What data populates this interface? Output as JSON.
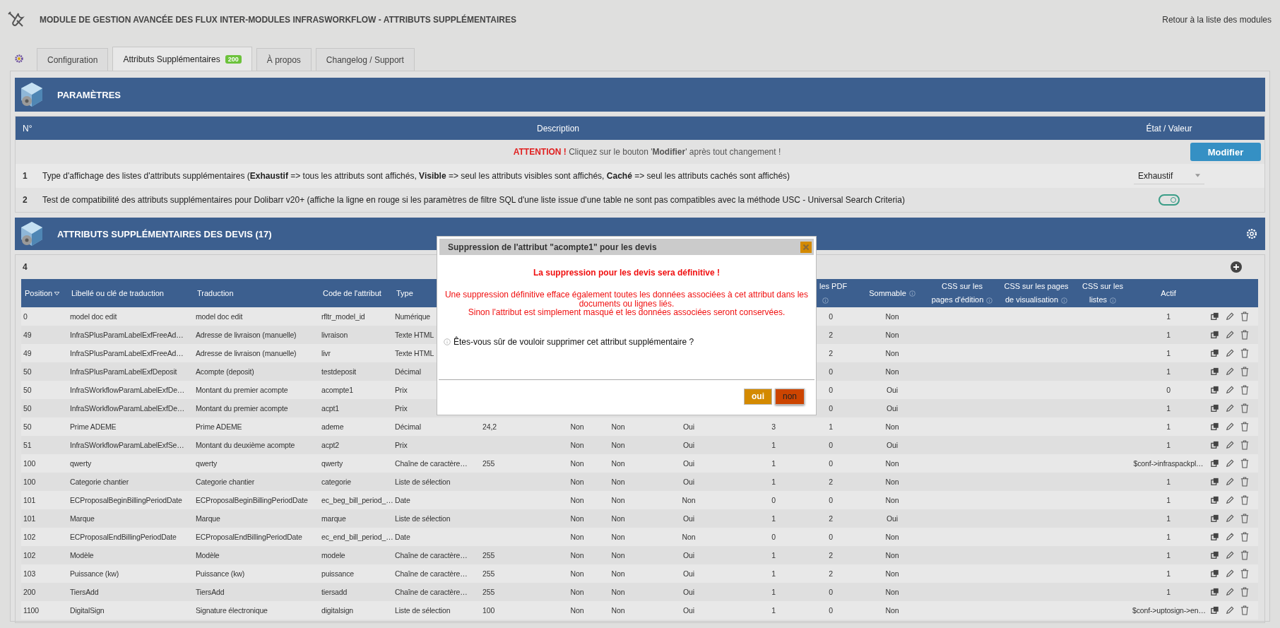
{
  "app": {
    "title": "MODULE DE GESTION AVANCÉE DES FLUX INTER-MODULES INFRASWORKFLOW - ATTRIBUTS SUPPLÉMENTAIRES",
    "back_link": "Retour à la liste des modules"
  },
  "tabs": [
    {
      "label": "Configuration",
      "selected": false
    },
    {
      "label": "Attributs Supplémentaires",
      "badge": "200",
      "selected": true
    },
    {
      "label": "À propos",
      "selected": false
    },
    {
      "label": "Changelog / Support",
      "selected": false
    }
  ],
  "parameters": {
    "title": "PARAMÈTRES",
    "columns": [
      "N°",
      "Description",
      "État / Valeur"
    ],
    "notice_label": "ATTENTION !",
    "notice": "Cliquez sur le bouton '**Modifier**' après tout changement !",
    "submit": "Modifier",
    "rows": [
      {
        "number": "1",
        "kind": "select",
        "description": "Type d'affichage des listes d'attributs supplémentaires (**Exhaustif** => tous les attributs sont affichés, **Visible** => seul les attributs visibles sont affichés, **Caché** => seul les attributs cachés sont affichés)",
        "value": "Exhaustif"
      },
      {
        "number": "2",
        "kind": "toggle",
        "description": "Test de compatibilité des attributs supplémentaires pour Dolibarr v20+ (affiche la ligne en rouge si les paramètres de filtre SQL d'une liste issue d'une table ne sont pas compatibles avec la méthode USC - Universal Search Criteria)",
        "on": true
      }
    ]
  },
  "attributes": {
    "title": "ATTRIBUTS SUPPLÉMENTAIRES DES DEVIS (17)",
    "count": "4",
    "columns": [
      {
        "label": "Position",
        "sorted": true
      },
      {
        "label": "Libellé ou clé de traduction"
      },
      {
        "label": "Traduction"
      },
      {
        "label": "Code de l'attribut"
      },
      {
        "label": "Type"
      },
      null,
      null,
      null,
      null,
      null,
      {
        "label": "les PDF",
        "info": true
      },
      {
        "label": "Sommable",
        "info": true
      },
      {
        "label": "CSS sur les pages d'édition",
        "info": true
      },
      {
        "label": "CSS sur les pages de visualisation",
        "info": true
      },
      {
        "label": "CSS sur les listes",
        "info": true
      },
      {
        "label": "Actif"
      }
    ],
    "rows": [
      {
        "cells": [
          "0",
          "model doc edit",
          "model doc edit",
          "rfltr_model_id",
          "Numérique",
          null,
          null,
          null,
          null,
          null,
          "0",
          "Non",
          null,
          null,
          null,
          "1"
        ]
      },
      {
        "cells": [
          "49",
          "InfraSPlusParamLabelExfFreeAd…",
          "Adresse de livraison (manuelle)",
          "livraison",
          "Texte HTML",
          null,
          null,
          null,
          null,
          null,
          "2",
          "Non",
          null,
          null,
          null,
          "1"
        ]
      },
      {
        "cells": [
          "49",
          "InfraSPlusParamLabelExfFreeAd…",
          "Adresse de livraison (manuelle)",
          "livr",
          "Texte HTML",
          null,
          null,
          null,
          null,
          null,
          "2",
          "Non",
          null,
          null,
          null,
          "1"
        ]
      },
      {
        "cells": [
          "50",
          "InfraSPlusParamLabelExfDeposit",
          "Acompte (deposit)",
          "testdeposit",
          "Décimal",
          null,
          null,
          null,
          null,
          null,
          "0",
          "Non",
          null,
          null,
          null,
          "1"
        ]
      },
      {
        "cells": [
          "50",
          "InfraSWorkflowParamLabelExfDe…",
          "Montant du premier acompte",
          "acompte1",
          "Prix",
          null,
          null,
          null,
          null,
          null,
          "0",
          "Oui",
          null,
          null,
          null,
          "0"
        ]
      },
      {
        "cells": [
          "50",
          "InfraSWorkflowParamLabelExfDe…",
          "Montant du premier acompte",
          "acpt1",
          "Prix",
          null,
          null,
          null,
          null,
          null,
          "0",
          "Oui",
          null,
          null,
          null,
          "1"
        ]
      },
      {
        "cells": [
          "50",
          "Prime ADEME",
          "Prime ADEME",
          "ademe",
          "Décimal",
          "24,2",
          "Non",
          "Non",
          "Oui",
          "3",
          "1",
          "Non",
          null,
          null,
          null,
          "1"
        ]
      },
      {
        "cells": [
          "51",
          "InfraSWorkflowParamLabelExfSe…",
          "Montant du deuxième acompte",
          "acpt2",
          "Prix",
          null,
          "Non",
          "Non",
          "Oui",
          "1",
          "0",
          "Oui",
          null,
          null,
          null,
          "1"
        ]
      },
      {
        "cells": [
          "100",
          "qwerty",
          "qwerty",
          "qwerty",
          "Chaîne de caractère…",
          "255",
          "Non",
          "Non",
          "Oui",
          "1",
          "0",
          "Non",
          null,
          null,
          null,
          "$conf->infraspackpl…"
        ]
      },
      {
        "cells": [
          "100",
          "Categorie chantier",
          "Categorie chantier",
          "categorie",
          "Liste de sélection",
          null,
          "Non",
          "Non",
          "Oui",
          "1",
          "2",
          "Non",
          null,
          null,
          null,
          "1"
        ]
      },
      {
        "cells": [
          "101",
          "ECProposalBeginBillingPeriodDate",
          "ECProposalBeginBillingPeriodDate",
          "ec_beg_bill_period_…",
          "Date",
          null,
          "Non",
          "Non",
          "Non",
          "0",
          "0",
          "Non",
          null,
          null,
          null,
          "1"
        ]
      },
      {
        "cells": [
          "101",
          "Marque",
          "Marque",
          "marque",
          "Liste de sélection",
          null,
          "Non",
          "Non",
          "Oui",
          "1",
          "2",
          "Oui",
          null,
          null,
          null,
          "1"
        ]
      },
      {
        "cells": [
          "102",
          "ECProposalEndBillingPeriodDate",
          "ECProposalEndBillingPeriodDate",
          "ec_end_bill_period_…",
          "Date",
          null,
          "Non",
          "Non",
          "Non",
          "0",
          "0",
          "Non",
          null,
          null,
          null,
          "1"
        ]
      },
      {
        "cells": [
          "102",
          "Modèle",
          "Modèle",
          "modele",
          "Chaîne de caractère…",
          "255",
          "Non",
          "Non",
          "Oui",
          "1",
          "2",
          "Non",
          null,
          null,
          null,
          "1"
        ]
      },
      {
        "cells": [
          "103",
          "Puissance (kw)",
          "Puissance (kw)",
          "puissance",
          "Chaîne de caractère…",
          "255",
          "Non",
          "Non",
          "Oui",
          "1",
          "2",
          "Non",
          null,
          null,
          null,
          "1"
        ]
      },
      {
        "cells": [
          "200",
          "TiersAdd",
          "TiersAdd",
          "tiersadd",
          "Chaîne de caractère…",
          "255",
          "Non",
          "Non",
          "Oui",
          "1",
          "0",
          "Non",
          null,
          null,
          null,
          "1"
        ]
      },
      {
        "cells": [
          "1100",
          "DigitalSign",
          "Signature électronique",
          "digitalsign",
          "Liste de sélection",
          "100",
          "Non",
          "Non",
          "Oui",
          "1",
          "0",
          "Non",
          null,
          null,
          null,
          "$conf->uptosign->en…"
        ]
      }
    ]
  },
  "dialog": {
    "title": "Suppression de l'attribut \"acompte1\" pour les devis",
    "warning": "La suppression pour les devis sera définitive !",
    "details": [
      "Une suppression définitive efface également toutes les données associées à cet attribut dans les documents ou lignes liés.",
      "Sinon l'attribut est simplement masqué et les données associées seront conservées."
    ],
    "question": "Êtes-vous sûr de vouloir supprimer cet attribut supplémentaire ?",
    "buttons": [
      {
        "label": "oui",
        "kind": "confirm"
      },
      {
        "label": "non",
        "kind": "cancel"
      }
    ]
  }
}
